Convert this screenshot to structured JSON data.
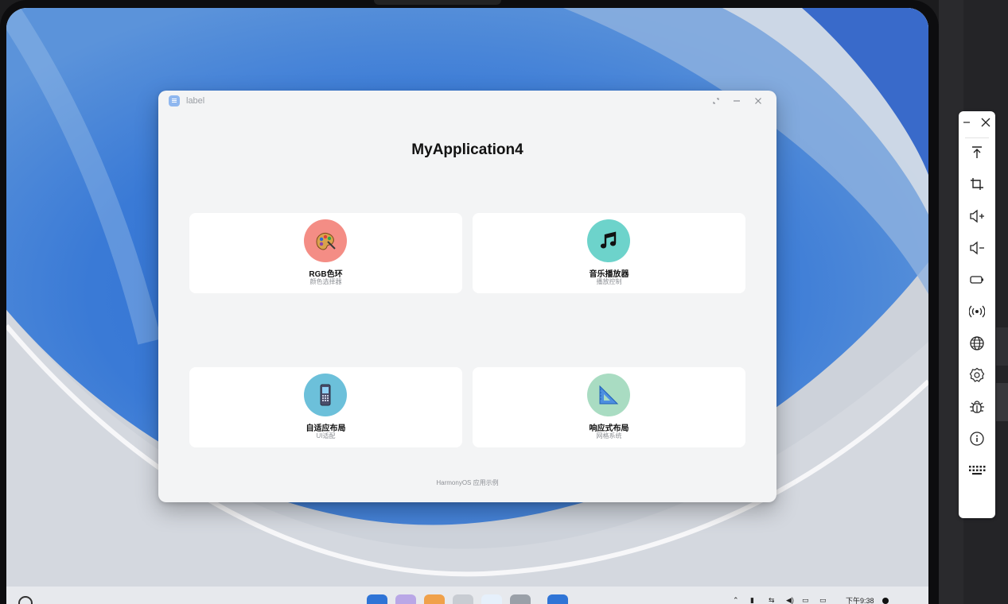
{
  "window": {
    "title": "label",
    "heading": "MyApplication4",
    "footer": "HarmonyOS 应用示例"
  },
  "cards": [
    {
      "title": "RGB色环",
      "subtitle": "颜色选择器",
      "icon": "palette-icon",
      "color": "#f48d85"
    },
    {
      "title": "音乐播放器",
      "subtitle": "播放控制",
      "icon": "music-note-icon",
      "color": "#6dd3cb"
    },
    {
      "title": "自适应布局",
      "subtitle": "UI适配",
      "icon": "mobile-phone-icon",
      "color": "#6cc0da"
    },
    {
      "title": "响应式布局",
      "subtitle": "网格系统",
      "icon": "triangle-ruler-icon",
      "color": "#a9dcc2"
    }
  ],
  "toolbar": {
    "items": [
      "minimize-icon",
      "close-icon",
      "rotate-to-top-icon",
      "crop-icon",
      "volume-up-icon",
      "volume-down-icon",
      "battery-icon",
      "wireless-icon",
      "globe-icon",
      "settings-icon",
      "bug-icon",
      "info-icon",
      "keyboard-icon"
    ]
  },
  "taskbar": {
    "clock": "下午9:38"
  },
  "colors": {
    "window_bg": "#f3f4f5",
    "card_bg": "#ffffff",
    "accent": "#4a7fc4"
  }
}
